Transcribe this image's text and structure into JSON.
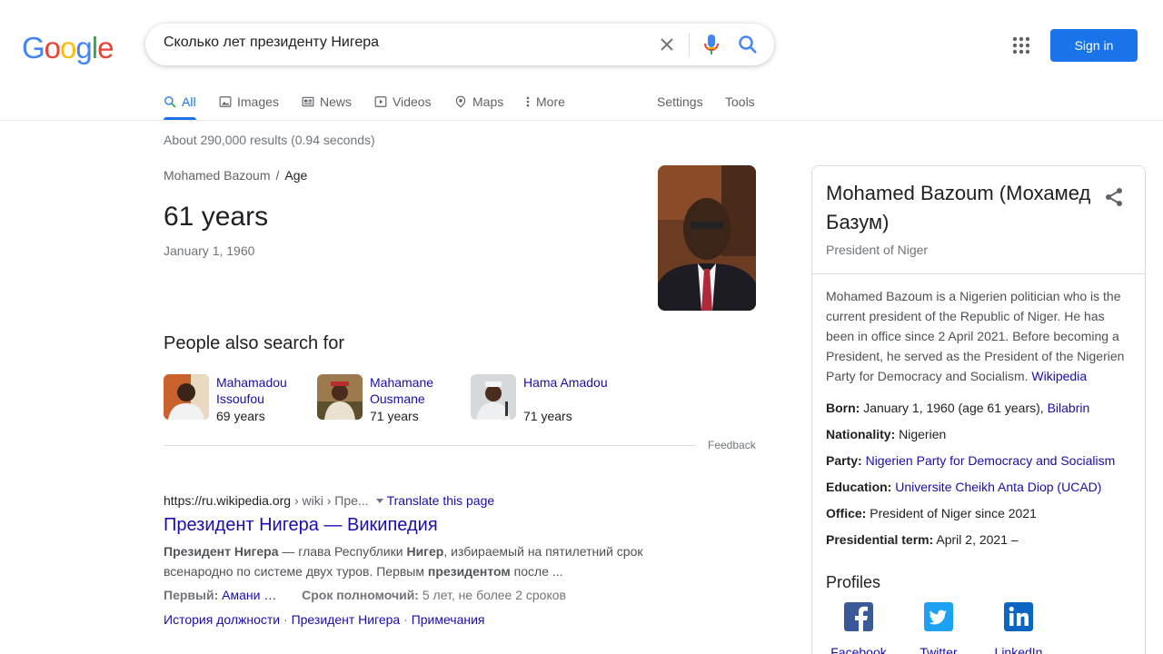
{
  "logo": {
    "letters": [
      "G",
      "o",
      "o",
      "g",
      "l",
      "e"
    ],
    "colors": [
      "#4285f4",
      "#ea4335",
      "#fbbc05",
      "#4285f4",
      "#34a853",
      "#ea4335"
    ]
  },
  "search": {
    "value": "Сколько лет президенту Нигера"
  },
  "header": {
    "signin_label": "Sign in"
  },
  "tabs": [
    {
      "label": "All",
      "icon": "search-icon"
    },
    {
      "label": "Images",
      "icon": "image-icon"
    },
    {
      "label": "News",
      "icon": "news-icon"
    },
    {
      "label": "Videos",
      "icon": "play-icon"
    },
    {
      "label": "Maps",
      "icon": "map-pin-icon"
    },
    {
      "label": "More",
      "icon": "kebab-icon"
    },
    {
      "label": "Settings"
    },
    {
      "label": "Tools"
    }
  ],
  "stats": "About 290,000 results (0.94 seconds)",
  "answer": {
    "crumb_entity": "Mohamed Bazoum",
    "crumb_sep": "/",
    "crumb_attr": "Age",
    "value": "61 years",
    "sub": "January 1, 1960"
  },
  "pasf": {
    "title": "People also search for",
    "people": [
      {
        "name": "Mahamadou Issoufou",
        "age": "69 years"
      },
      {
        "name": "Mahamane Ousmane",
        "age": "71 years"
      },
      {
        "name": "Hama Amadou",
        "age": "71 years"
      }
    ],
    "feedback": "Feedback"
  },
  "result": {
    "url_domain": "https://ru.wikipedia.org",
    "url_path": " › wiki › Пре...",
    "translate": "Translate this page",
    "title": "Президент Нигера — Википедия",
    "snippet_parts": [
      {
        "b": "Президент Нигера"
      },
      {
        "t": " — глава Республики "
      },
      {
        "b": "Нигер"
      },
      {
        "t": ", избираемый на пятилетний срок всенародно по системе двух туров. Первым "
      },
      {
        "b": "президентом"
      },
      {
        "t": " после ..."
      }
    ],
    "meta": [
      {
        "key": "Первый:",
        "value": "Амани …"
      },
      {
        "key": "Срок полномочий:",
        "value": "5 лет, не более 2 сроков"
      }
    ],
    "sitelinks": [
      "История должности",
      "Президент Нигера",
      "Примечания"
    ],
    "sitelink_sep": " · "
  },
  "kp": {
    "title": "Mohamed Bazoum (Мохамед Базум)",
    "subtitle": "President of Niger",
    "desc": "Mohamed Bazoum is a Nigerien politician who is the current president of the Republic of Niger. He has been in office since 2 April 2021. Before becoming a President, he served as the President of the Nigerien Party for Democracy and Socialism.",
    "desc_source": "Wikipedia",
    "facts": [
      {
        "label": "Born:",
        "text": "January 1, 1960 (age 61 years), ",
        "link": "Bilabrin"
      },
      {
        "label": "Nationality:",
        "text": "Nigerien",
        "link": ""
      },
      {
        "label": "Party:",
        "text": "",
        "link": "Nigerien Party for Democracy and Socialism"
      },
      {
        "label": "Education:",
        "text": "",
        "link": "Universite Cheikh Anta Diop (UCAD)"
      },
      {
        "label": "Office:",
        "text": "President of Niger since 2021",
        "link": ""
      },
      {
        "label": "Presidential term:",
        "text": "April 2, 2021 –",
        "link": ""
      }
    ],
    "profiles_title": "Profiles",
    "profiles": [
      {
        "label": "Facebook",
        "color": "#3b5998",
        "icon": "facebook-icon"
      },
      {
        "label": "Twitter",
        "color": "#1da1f2",
        "icon": "twitter-icon"
      },
      {
        "label": "LinkedIn",
        "color": "#0a66c2",
        "icon": "linkedin-icon"
      }
    ]
  }
}
